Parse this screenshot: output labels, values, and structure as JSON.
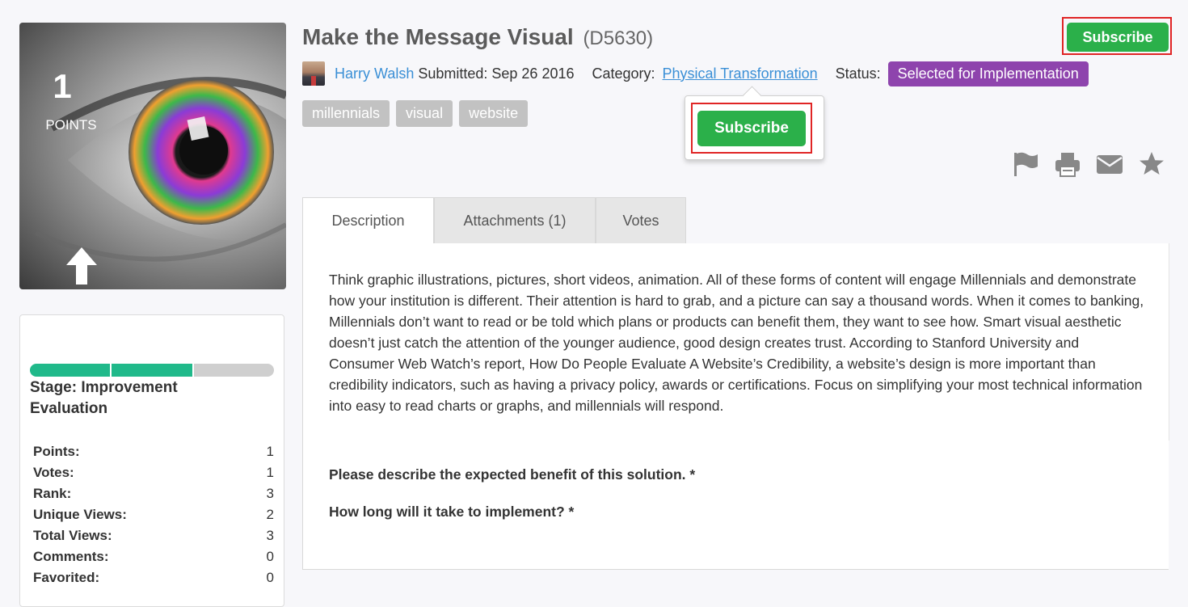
{
  "idea": {
    "title": "Make the Message Visual",
    "id": "(D5630)",
    "author": "Harry Walsh",
    "submitted": "Submitted: Sep 26 2016",
    "category_label": "Category:",
    "category": "Physical Transformation",
    "status_label": "Status:",
    "status": "Selected for Implementation",
    "tags": [
      "millennials",
      "visual",
      "website"
    ]
  },
  "score": {
    "points": "1",
    "points_label": "POINTS"
  },
  "subscribe": {
    "label": "Subscribe",
    "popover_label": "Subscribe"
  },
  "actions": [
    "flag-icon",
    "print-icon",
    "email-icon",
    "star-icon"
  ],
  "stage": {
    "label": "Stage: Improvement Evaluation",
    "segments_done": 2,
    "segments_total": 3
  },
  "stats": [
    {
      "label": "Points:",
      "value": "1"
    },
    {
      "label": "Votes:",
      "value": "1"
    },
    {
      "label": "Rank:",
      "value": "3"
    },
    {
      "label": "Unique Views:",
      "value": "2"
    },
    {
      "label": "Total Views:",
      "value": "3"
    },
    {
      "label": "Comments:",
      "value": "0"
    },
    {
      "label": "Favorited:",
      "value": "0"
    }
  ],
  "tabs": [
    {
      "label": "Description",
      "active": true
    },
    {
      "label": "Attachments (1)",
      "active": false
    },
    {
      "label": "Votes",
      "active": false
    }
  ],
  "description": "Think graphic illustrations, pictures, short videos, animation. All of these forms of content will engage Millennials and demonstrate how your institution is different. Their attention is hard to grab, and a picture can say a thousand words. When it comes to banking, Millennials don’t want to read or be told which plans or products can benefit them, they want to see how. Smart visual aesthetic doesn’t just catch the attention of the younger audience, good design creates trust. According to Stanford University and Consumer Web Watch’s report, How Do People Evaluate A Website’s Credibility, a website’s design is more important than credibility indicators, such as having a privacy policy, awards or certifications. Focus on simplifying your most technical information into easy to read charts or graphs, and millennials will respond.",
  "questions": [
    "Please describe the expected benefit of this solution. *",
    "How long will it take to implement? *"
  ],
  "colors": {
    "accent_green": "#2bb04a",
    "status_purple": "#8e44ad",
    "link_blue": "#3a8fd6",
    "progress_teal": "#20b98a",
    "tag_gray": "#c2c2c2"
  }
}
